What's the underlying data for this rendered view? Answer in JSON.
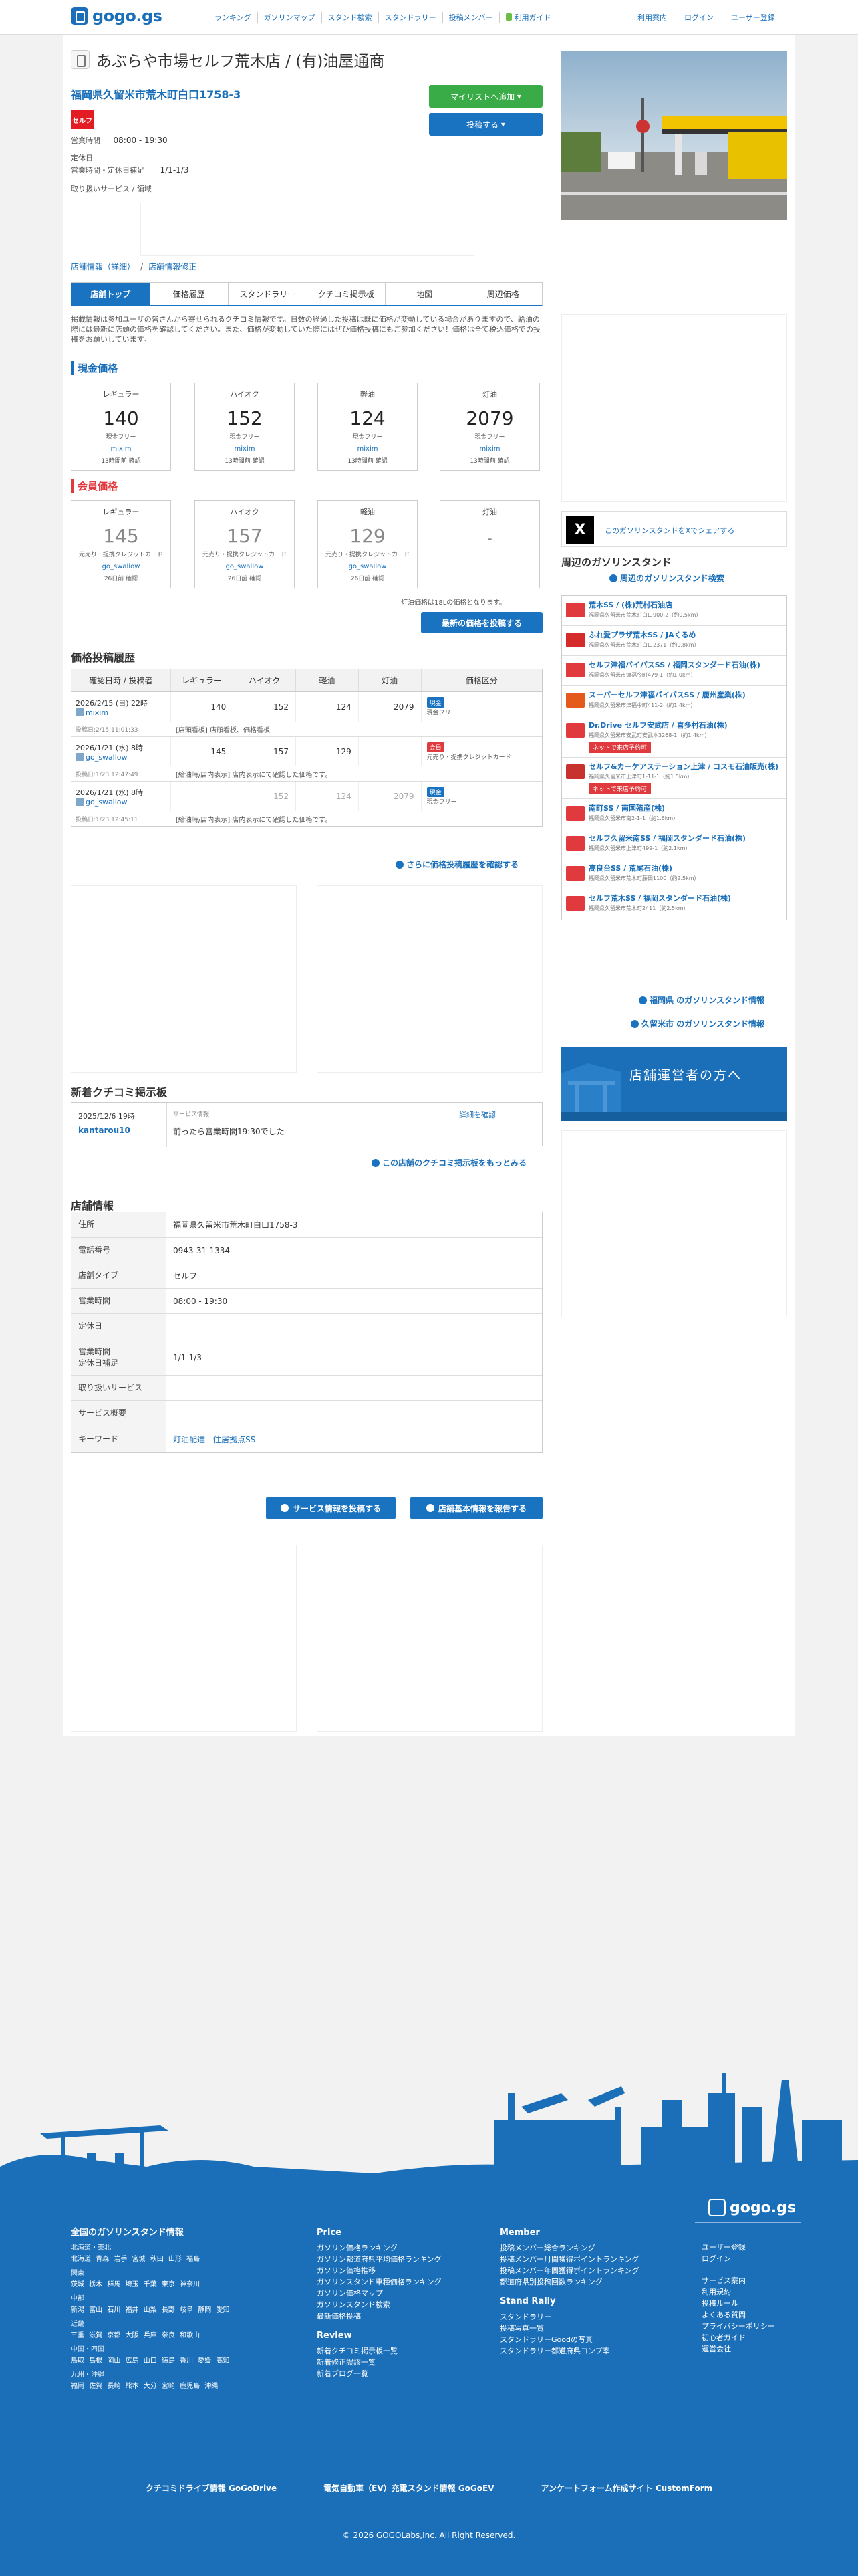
{
  "header": {
    "logo": "gogo.gs",
    "nav": [
      "ランキング",
      "ガソリンマップ",
      "スタンド検索",
      "スタンドラリー",
      "投稿メンバー"
    ],
    "guide": "利用ガイド",
    "right_nav": [
      "利用案内",
      "ログイン",
      "ユーザー登録"
    ]
  },
  "station": {
    "name": "あぶらや市場セルフ荒木店 / (有)油屋通商",
    "address": "福岡県久留米市荒木町白口1758-3",
    "brand_logo": "セルフ",
    "hours_label": "営業時間",
    "hours": "08:00 - 19:30",
    "holiday_label": "定休日",
    "holiday_hours_label": "営業時間・定休日補足",
    "holiday_note": "1/1-1/3",
    "services_label": "取り扱いサービス / 領域",
    "mylist_btn": "マイリストへ追加",
    "post_btn": "投稿する"
  },
  "breadcrumb": [
    "店舗情報（詳細）",
    "/",
    "店舗情報修正"
  ],
  "tabs": [
    "店舗トップ",
    "価格履歴",
    "スタンドラリー",
    "クチコミ掲示板",
    "地図",
    "周辺価格"
  ],
  "notice": "掲載情報は参加ユーザの皆さんから寄せられるクチコミ情報です。日数の経過した投稿は既に価格が変動している場合がありますので、給油の際には最新に店頭の価格を確認してください。また、価格が変動していた際にはぜひ価格投稿にもご参加ください！価格は全て税込価格での投稿をお願いしています。",
  "cash": {
    "label": "現金価格",
    "cards": [
      {
        "type": "レギュラー",
        "price": "140",
        "note": "現金フリー",
        "user": "mixim",
        "time": "13時間前 確認"
      },
      {
        "type": "ハイオク",
        "price": "152",
        "note": "現金フリー",
        "user": "mixim",
        "time": "13時間前 確認"
      },
      {
        "type": "軽油",
        "price": "124",
        "note": "現金フリー",
        "user": "mixim",
        "time": "13時間前 確認"
      },
      {
        "type": "灯油",
        "price": "2079",
        "note": "現金フリー",
        "user": "mixim",
        "time": "13時間前 確認"
      }
    ]
  },
  "member": {
    "label": "会員価格",
    "cards": [
      {
        "type": "レギュラー",
        "price": "145",
        "note": "元売り・提携クレジットカード",
        "user": "go_swallow",
        "time": "26日前 確認"
      },
      {
        "type": "ハイオク",
        "price": "157",
        "note": "元売り・提携クレジットカード",
        "user": "go_swallow",
        "time": "26日前 確認"
      },
      {
        "type": "軽油",
        "price": "129",
        "note": "元売り・提携クレジットカード",
        "user": "go_swallow",
        "time": "26日前 確認"
      },
      {
        "type": "灯油",
        "price": "-",
        "note": "",
        "user": "",
        "time": ""
      }
    ]
  },
  "tax_note": "灯油価格は18Lの価格となります。",
  "latest_btn": "最新の価格を投稿する",
  "history": {
    "title": "価格投稿履歴",
    "headers": [
      "確認日時 / 投稿者",
      "レギュラー",
      "ハイオク",
      "軽油",
      "灯油",
      "価格区分"
    ],
    "rows": [
      {
        "date": "2026/2/15 (日) 22時",
        "user": "mixim",
        "reg": "140",
        "hi": "152",
        "diesel": "124",
        "kero": "2079",
        "kind_badge": "現金",
        "kind": "現金フリー",
        "post_date": "投稿日:2/15 11:01:33",
        "comment": "[店頭看板] 店頭看板、価格看板",
        "badge_cls": "cash",
        "gray": false
      },
      {
        "date": "2026/1/21 (水) 8時",
        "user": "go_swallow",
        "reg": "145",
        "hi": "157",
        "diesel": "129",
        "kero": "",
        "kind_badge": "会員",
        "kind": "元売り・提携クレジットカード",
        "post_date": "投稿日:1/23 12:47:49",
        "comment": "[給油時/店内表示] 店内表示にて確認した価格です。",
        "badge_cls": "mem",
        "gray": false
      },
      {
        "date": "2026/1/21 (水) 8時",
        "user": "go_swallow",
        "reg": "",
        "hi": "152",
        "diesel": "124",
        "kero": "2079",
        "kind_badge": "現金",
        "kind": "現金フリー",
        "post_date": "投稿日:1/23 12:45:11",
        "comment": "[給油時/店内表示] 店内表示にて確認した価格です。",
        "badge_cls": "cash",
        "gray": true
      }
    ],
    "more": "さらに価格投稿履歴を確認する"
  },
  "reviews": {
    "title": "新着クチコミ掲示板",
    "date": "2025/12/6 19時",
    "user": "kantarou10",
    "category": "サービス情報",
    "text": "前ったら営業時間19:30でした",
    "detail": "詳細を確認",
    "more": "この店舗のクチコミ掲示板をもっとみる"
  },
  "info": {
    "title": "店舗情報",
    "rows": [
      {
        "k": "住所",
        "v": "福岡県久留米市荒木町白口1758-3"
      },
      {
        "k": "電話番号",
        "v": "0943-31-1334"
      },
      {
        "k": "店舗タイプ",
        "v": "セルフ"
      },
      {
        "k": "営業時間",
        "v": "08:00 - 19:30"
      },
      {
        "k": "定休日",
        "v": ""
      },
      {
        "k": "営業時間\n定休日補足",
        "v": "1/1-1/3"
      },
      {
        "k": "取り扱いサービス",
        "v": ""
      },
      {
        "k": "サービス概要",
        "v": ""
      },
      {
        "k": "キーワード",
        "v": ""
      }
    ],
    "keywords": [
      "灯油配達",
      "住居拠点SS"
    ],
    "service_btn": "サービス情報を投稿する",
    "basic_btn": "店舗基本情報を報告する"
  },
  "sidebar": {
    "share_x": "X",
    "share_text": "このガソリンスタンドをXでシェアする",
    "nearby_title": "周辺のガソリンスタンド",
    "nearby_search": "周辺のガソリンスタンド検索",
    "nearby": [
      {
        "name": "荒木SS / (株)荒村石油店",
        "addr": "福岡県久留米市荒木町白口900-2（約0.5km）",
        "color": "#e0393e",
        "reserve": ""
      },
      {
        "name": "ふれ愛プラザ荒木SS / JAくるめ",
        "addr": "福岡県久留米市荒木町白口2371（約0.8km）",
        "color": "#d62b2b",
        "reserve": ""
      },
      {
        "name": "セルフ津福バイパスSS / 福岡スタンダード石油(株)",
        "addr": "福岡県久留米市津福今町479-1（約1.0km）",
        "color": "#e0393e",
        "reserve": ""
      },
      {
        "name": "スーパーセルフ津福バイパスSS / 鹿州産業(株)",
        "addr": "福岡県久留米市津福今町411-2（約1.4km）",
        "color": "#e35a1c",
        "reserve": ""
      },
      {
        "name": "Dr.Drive セルフ安武店 / 喜多村石油(株)",
        "addr": "福岡県久留米市安武町安武本3268-1（約1.4km）",
        "color": "#e0393e",
        "reserve": "ネットで来店予約可"
      },
      {
        "name": "セルフ&カーケアステーション上津 / コスモ石油販売(株)",
        "addr": "福岡県久留米市上津町1-11-1（約1.5km）",
        "color": "#c7322f",
        "reserve": "ネットで来店予約可"
      },
      {
        "name": "南町SS / 南国殖産(株)",
        "addr": "福岡県久留米市南2-1-1（約1.6km）",
        "color": "#e0393e",
        "reserve": ""
      },
      {
        "name": "セルフ久留米南SS / 福岡スタンダード石油(株)",
        "addr": "福岡県久留米市上津町499-1（約2.1km）",
        "color": "#e0393e",
        "reserve": ""
      },
      {
        "name": "高良台SS / 荒尾石油(株)",
        "addr": "福岡県久留米市荒木町藤田1100（約2.5km）",
        "color": "#e0393e",
        "reserve": ""
      },
      {
        "name": "セルフ荒木SS / 福岡スタンダード石油(株)",
        "addr": "福岡県久留米市荒木町2411（約2.5km）",
        "color": "#e0393e",
        "reserve": ""
      }
    ],
    "pref_link": "福岡県 のガソリンスタンド情報",
    "city_link": "久留米市 のガソリンスタンド情報",
    "owner_banner": "店舗運営者の方へ"
  },
  "footer": {
    "logo": "gogo.gs",
    "col1_title": "全国のガソリンスタンド情報",
    "regions": [
      {
        "name": "北海道・東北",
        "prefs": "北海道 青森 岩手 宮城 秋田 山形 福島"
      },
      {
        "name": "関東",
        "prefs": "茨城 栃木 群馬 埼玉 千葉 東京 神奈川"
      },
      {
        "name": "中部",
        "prefs": "新潟 富山 石川 福井 山梨 長野 岐阜 静岡 愛知"
      },
      {
        "name": "近畿",
        "prefs": "三重 滋賀 京都 大阪 兵庫 奈良 和歌山"
      },
      {
        "name": "中国・四国",
        "prefs": "鳥取 島根 岡山 広島 山口 徳島 香川 愛媛 高知"
      },
      {
        "name": "九州・沖縄",
        "prefs": "福岡 佐賀 長崎 熊本 大分 宮崎 鹿児島 沖縄"
      }
    ],
    "price_title": "Price",
    "price_links": [
      "ガソリン価格ランキング",
      "ガソリン都道府県平均価格ランキング",
      "ガソリン価格推移",
      "ガソリンスタンド車種価格ランキング",
      "ガソリン価格マップ",
      "ガソリンスタンド検索",
      "最新価格投稿"
    ],
    "review_title": "Review",
    "review_links": [
      "新着クチコミ掲示板一覧",
      "新着修正誤謬一覧",
      "新着ブログ一覧"
    ],
    "member_title": "Member",
    "member_links": [
      "投稿メンバー総合ランキング",
      "投稿メンバー月間獲得ポイントランキング",
      "投稿メンバー年間獲得ポイントランキング",
      "都道府県別投稿回数ランキング"
    ],
    "rally_title": "Stand Rally",
    "rally_links": [
      "スタンドラリー",
      "投稿写真一覧",
      "スタンドラリーGoodの写真",
      "スタンドラリー都道府県コンプ率"
    ],
    "util_links": [
      "ユーザー登録",
      "ログイン",
      "サービス案内",
      "利用規約",
      "投稿ルール",
      "よくある質問",
      "プライバシーポリシー",
      "初心者ガイド",
      "運営会社"
    ],
    "bottom_links": [
      "クチコミドライブ情報 GoGoDrive",
      "電気自動車（EV）充電スタンド情報 GoGoEV",
      "アンケートフォーム作成サイト CustomForm"
    ],
    "copyright": "© 2026 GOGOLabs,Inc. All Right Reserved."
  }
}
